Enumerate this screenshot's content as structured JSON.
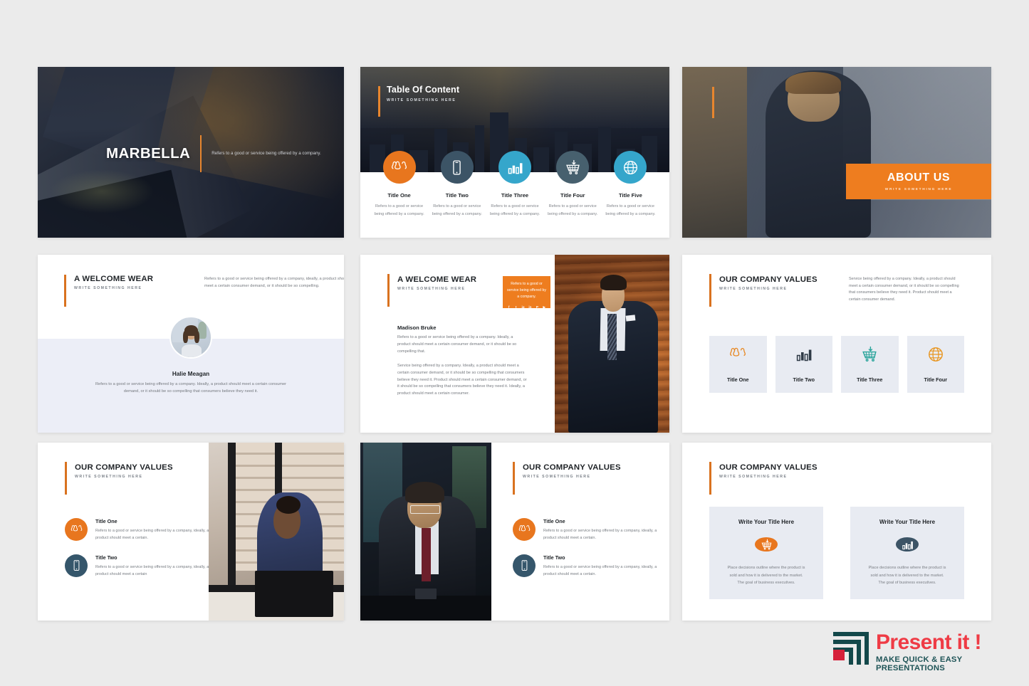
{
  "page": {
    "background_color": "#ebebeb",
    "accent_orange": "#e8761e",
    "slate_blue": "#3c5466",
    "light_blue": "#35a6cb",
    "card_lavender": "#e8ebf2"
  },
  "slides": {
    "slide1": {
      "title": "MARBELLA",
      "description": "Refers to a good or service being offered by a company."
    },
    "slide2": {
      "title": "Table Of Content",
      "subtitle": "WRITE SOMETHING HERE",
      "items": [
        {
          "icon": "people-icon",
          "title": "Title One",
          "text": "Refers to a good or service being offered by a company.",
          "color": "#e8761e"
        },
        {
          "icon": "mobile-icon",
          "title": "Title Two",
          "text": "Refers to a good or service being offered by a company.",
          "color": "#3c5466"
        },
        {
          "icon": "bar-chart-icon",
          "title": "Title Three",
          "text": "Refers to a good or service being offered by a company.",
          "color": "#35a6cb"
        },
        {
          "icon": "shopping-cart-icon",
          "title": "Title Four",
          "text": "Refers to a good or service being offered by a company.",
          "color": "#47606e"
        },
        {
          "icon": "globe-icon",
          "title": "Title Five",
          "text": "Refers to a good or service being offered by a company.",
          "color": "#35a6cb"
        }
      ]
    },
    "slide3": {
      "title": "ABOUT US",
      "subtitle": "WRITE SOMETHING HERE"
    },
    "slide4": {
      "title": "A WELCOME WEAR",
      "subtitle": "WRITE SOMETHING HERE",
      "description": "Refers to a good or service being offered by a company, ideally, a product should meet a certain consumer demand, or it should be so compelling.",
      "person_name": "Halie Meagan",
      "person_quote": "Refers to a good or service being offered by a company. Ideally, a product should meet a certain consumer demand, or it should be so compelling that consumers believe they need it."
    },
    "slide5": {
      "title": "A WELCOME WEAR",
      "subtitle": "WRITE SOMETHING HERE",
      "badge_text": "Refers to a good or service being offered by a company.",
      "social": [
        "facebook-icon",
        "twitter-icon",
        "instagram-icon",
        "linkedin-icon",
        "pinterest-icon",
        "youtube-icon"
      ],
      "social_glyphs": [
        "f",
        "t",
        "ig",
        "in",
        "P",
        "▶"
      ],
      "person_name": "Madison Bruke",
      "paragraph1": "Refers to a good or service being offered by a company. Ideally, a product should meet a certain consumer demand, or it should be so compelling that.",
      "paragraph2": "Service being offered by a company. Ideally, a product should meet a certain consumer demand, or it should be so compelling that consumers believe they need it. Product should meet a certain consumer demand, or it should be so compelling that consumers believe they need it. Ideally, a product should meet a certain consumer."
    },
    "slide6": {
      "title": "OUR COMPANY VALUES",
      "subtitle": "WRITE SOMETHING HERE",
      "description": "Service being offered by a company. Ideally, a product should meet a certain consumer demand, or it should be so compelling that consumers believe they need it. Product should meet a certain consumer demand.",
      "cards": [
        {
          "icon": "people-icon",
          "label": "Title One",
          "color": "#e8861e"
        },
        {
          "icon": "bar-chart-icon",
          "label": "Title Two",
          "color": "#2e3a46"
        },
        {
          "icon": "shopping-cart-icon",
          "label": "Title Three",
          "color": "#27a39a"
        },
        {
          "icon": "globe-icon",
          "label": "Title Four",
          "color": "#e8951e"
        }
      ]
    },
    "slide7": {
      "title": "OUR COMPANY VALUES",
      "subtitle": "WRITE SOMETHING HERE",
      "items": [
        {
          "icon": "people-icon",
          "title": "Title One",
          "text": "Refers to a good or service being offered by a company, ideally, a product should meet a certain.",
          "color": "#e8761e"
        },
        {
          "icon": "mobile-icon",
          "title": "Title Two",
          "text": "Refers to a good or service being offered by a company, ideally, a product should meet a certain",
          "color": "#35566b"
        }
      ]
    },
    "slide8": {
      "title": "OUR COMPANY VALUES",
      "subtitle": "WRITE SOMETHING HERE",
      "items": [
        {
          "icon": "people-icon",
          "title": "Title One",
          "text": "Refers to a good or service being offered by a company, ideally, a product should meet a certain.",
          "color": "#e8761e"
        },
        {
          "icon": "mobile-icon",
          "title": "Title Two",
          "text": "Refers to a good or service being offered by a company, ideally, a product should meet a certain.",
          "color": "#35566b"
        }
      ]
    },
    "slide9": {
      "title": "OUR COMPANY VALUES",
      "subtitle": "WRITE SOMETHING HERE",
      "cards": [
        {
          "icon": "shopping-cart-icon",
          "title": "Write Your Title Here",
          "text": "Place decisions outline where the product is sold and how it is delivered to the market. The goal of business executives.",
          "color": "#e8761e"
        },
        {
          "icon": "bar-chart-icon",
          "title": "Write Your Title Here",
          "text": "Place decisions outline where the product is sold and how it is delivered to the market. The goal of business executives.",
          "color": "#3c5466"
        }
      ]
    }
  },
  "logo": {
    "brand": "Present it !",
    "tagline": "MAKE QUICK & EASY PRESENTATIONS",
    "brand_color": "#ef3b45",
    "tagline_color": "#1f5457",
    "mark_color": "#13484a",
    "mark_square_color": "#d6203a"
  }
}
